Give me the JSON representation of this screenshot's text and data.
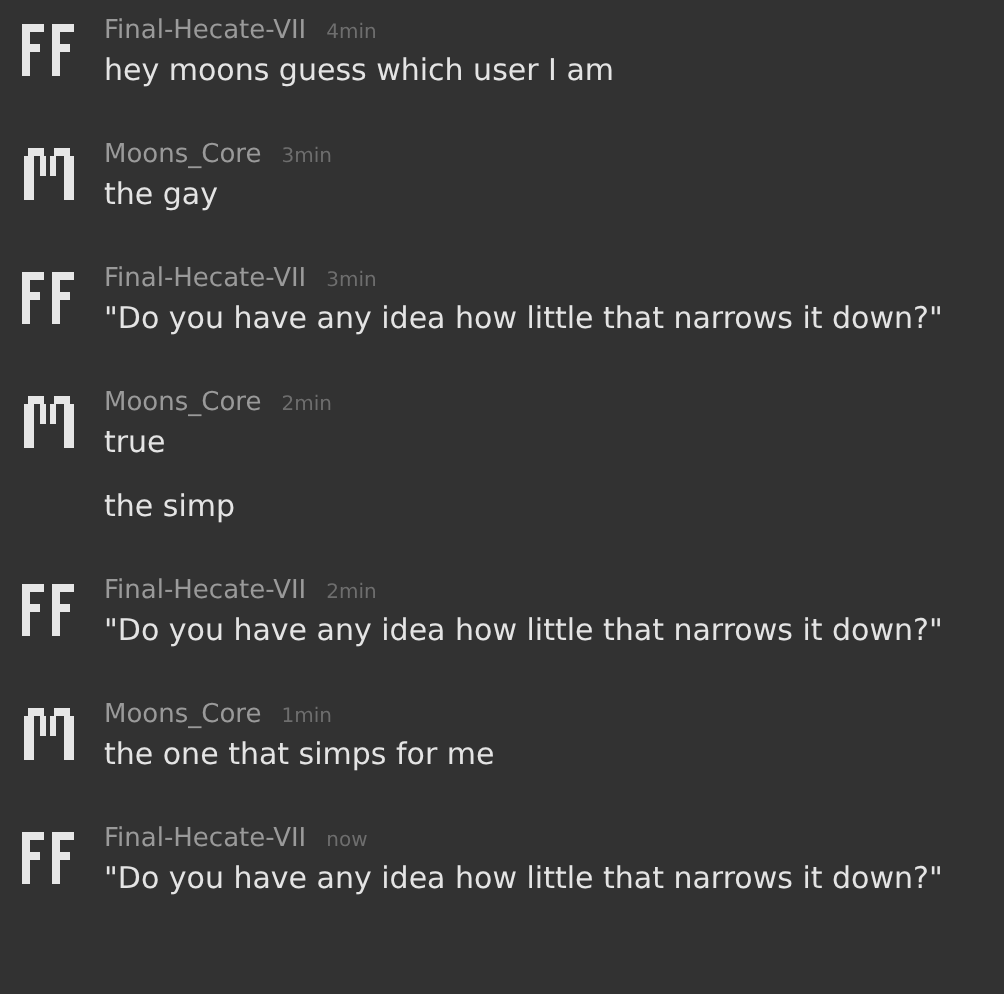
{
  "messages": [
    {
      "kind": "twin",
      "author": "Final-Hecate-VII",
      "time": "4min",
      "lines": [
        "hey moons guess which user I am"
      ]
    },
    {
      "kind": "arch",
      "author": "Moons_Core",
      "time": "3min",
      "lines": [
        "the gay"
      ]
    },
    {
      "kind": "twin",
      "author": "Final-Hecate-VII",
      "time": "3min",
      "lines": [
        "\"Do you have any idea how little that narrows it down?\""
      ]
    },
    {
      "kind": "arch",
      "author": "Moons_Core",
      "time": "2min",
      "lines": [
        "true",
        "the simp"
      ]
    },
    {
      "kind": "twin",
      "author": "Final-Hecate-VII",
      "time": "2min",
      "lines": [
        "\"Do you have any idea how little that narrows it down?\""
      ]
    },
    {
      "kind": "arch",
      "author": "Moons_Core",
      "time": "1min",
      "lines": [
        "the one that simps for me"
      ]
    },
    {
      "kind": "twin",
      "author": "Final-Hecate-VII",
      "time": "now",
      "lines": [
        "\"Do you have any idea how little that narrows it down?\""
      ]
    }
  ]
}
